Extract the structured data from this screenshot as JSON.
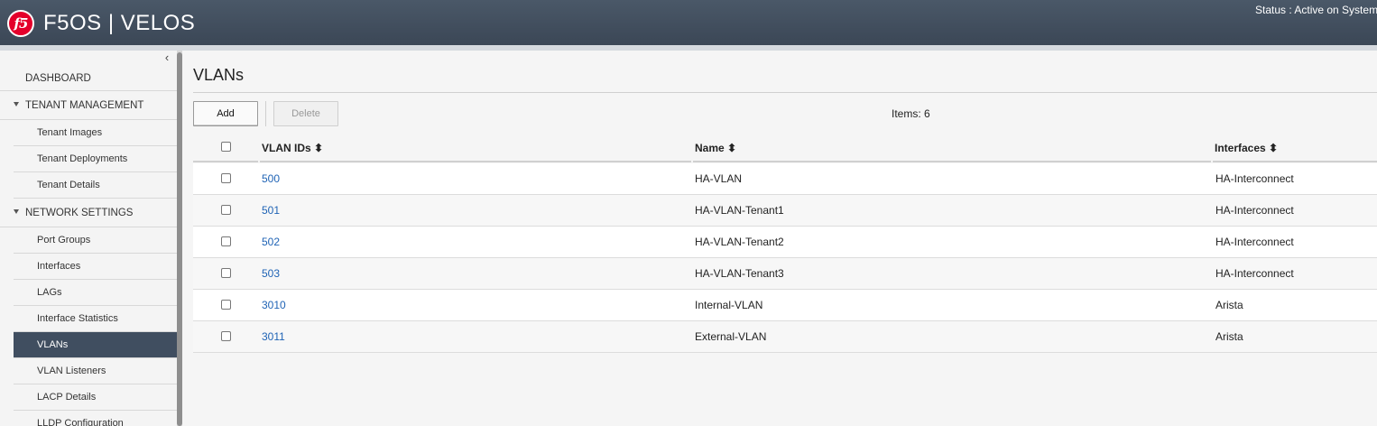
{
  "header": {
    "logo_text": "f5",
    "app_title": "F5OS | VELOS",
    "status": "Status : Active on System"
  },
  "sidebar": {
    "collapse_glyph": "‹",
    "items": [
      {
        "label": "DASHBOARD"
      },
      {
        "label": "TENANT MANAGEMENT"
      },
      {
        "label": "Tenant Images"
      },
      {
        "label": "Tenant Deployments"
      },
      {
        "label": "Tenant Details"
      },
      {
        "label": "NETWORK SETTINGS"
      },
      {
        "label": "Port Groups"
      },
      {
        "label": "Interfaces"
      },
      {
        "label": "LAGs"
      },
      {
        "label": "Interface Statistics"
      },
      {
        "label": "VLANs"
      },
      {
        "label": "VLAN Listeners"
      },
      {
        "label": "LACP Details"
      },
      {
        "label": "LLDP Configuration"
      }
    ],
    "active": "VLANs"
  },
  "main": {
    "title": "VLANs",
    "add_label": "Add",
    "delete_label": "Delete",
    "items_count": "Items: 6",
    "columns": {
      "vlan_ids": "VLAN IDs ⬍",
      "name": "Name ⬍",
      "interfaces": "Interfaces ⬍"
    },
    "rows": [
      {
        "id": "500",
        "name": "HA-VLAN",
        "interfaces": "HA-Interconnect"
      },
      {
        "id": "501",
        "name": "HA-VLAN-Tenant1",
        "interfaces": "HA-Interconnect"
      },
      {
        "id": "502",
        "name": "HA-VLAN-Tenant2",
        "interfaces": "HA-Interconnect"
      },
      {
        "id": "503",
        "name": "HA-VLAN-Tenant3",
        "interfaces": "HA-Interconnect"
      },
      {
        "id": "3010",
        "name": "Internal-VLAN",
        "interfaces": "Arista"
      },
      {
        "id": "3011",
        "name": "External-VLAN",
        "interfaces": "Arista"
      }
    ]
  },
  "colors": {
    "header_bg": "#3b4756",
    "active_nav_bg": "#404e60",
    "link": "#1f63b5",
    "logo_red": "#e4002b"
  }
}
